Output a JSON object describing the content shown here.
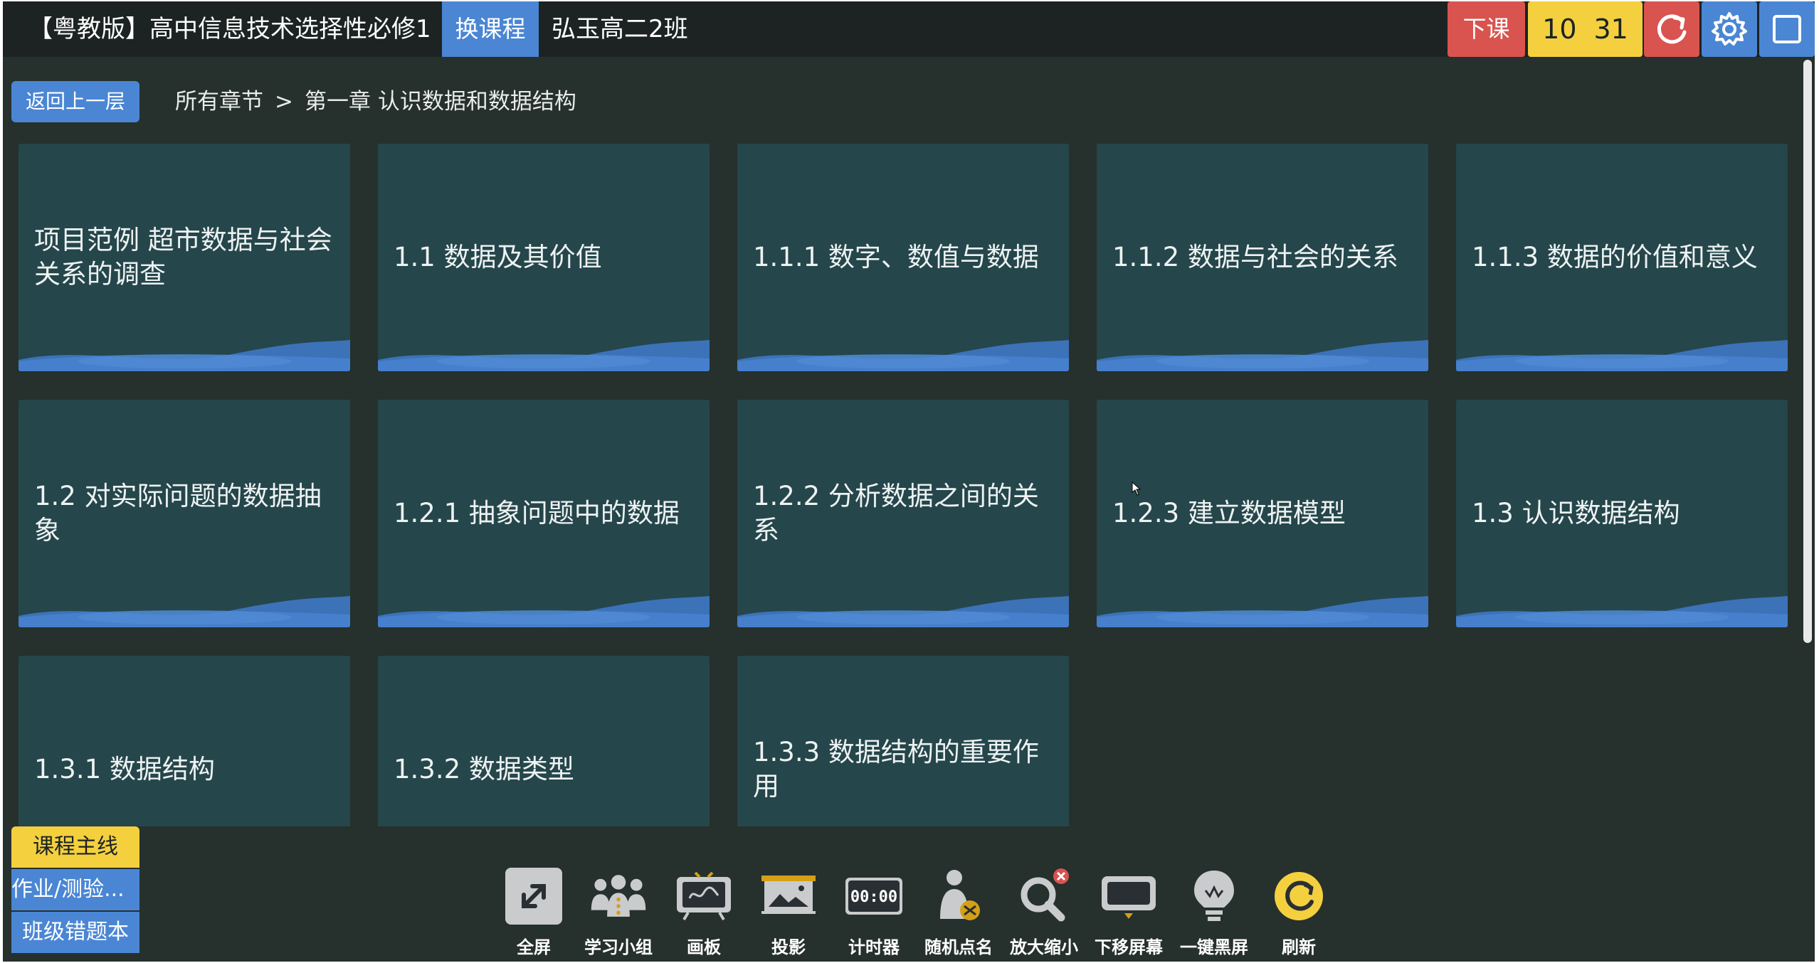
{
  "topbar": {
    "course_title": "【粤教版】高中信息技术选择性必修1",
    "switch_course": "换课程",
    "class_name": "弘玉高二2班",
    "end_class": "下课",
    "timer_min": "10",
    "timer_sec": "31",
    "icons": [
      "refresh-icon",
      "gear-icon",
      "window-icon"
    ]
  },
  "nav": {
    "back": "返回上一层",
    "crumb_root": "所有章节",
    "crumb_sep": ">",
    "crumb_current": "第一章 认识数据和数据结构"
  },
  "cards": [
    "项目范例 超市数据与社会关系的调查",
    "1.1 数据及其价值",
    "1.1.1 数字、数值与数据",
    "1.1.2 数据与社会的关系",
    "1.1.3 数据的价值和意义",
    "1.2 对实际问题的数据抽象",
    "1.2.1 抽象问题中的数据",
    "1.2.2 分析数据之间的关系",
    "1.2.3 建立数据模型",
    "1.3 认识数据结构",
    "1.3.1 数据结构",
    "1.3.2 数据类型",
    "1.3.3 数据结构的重要作用"
  ],
  "side": {
    "main_line": "课程主线",
    "homework": "作业/测验...",
    "wrong_book": "班级错题本"
  },
  "toolbar": [
    {
      "label": "全屏",
      "icon": "fullscreen-icon"
    },
    {
      "label": "学习小组",
      "icon": "group-icon"
    },
    {
      "label": "画板",
      "icon": "drawing-board-icon"
    },
    {
      "label": "投影",
      "icon": "projector-icon"
    },
    {
      "label": "计时器",
      "icon": "timer-icon",
      "display": "00:00"
    },
    {
      "label": "随机点名",
      "icon": "random-pick-icon"
    },
    {
      "label": "放大缩小",
      "icon": "magnifier-icon"
    },
    {
      "label": "下移屏幕",
      "icon": "screen-down-icon"
    },
    {
      "label": "一键黑屏",
      "icon": "lightbulb-icon"
    },
    {
      "label": "刷新",
      "icon": "refresh-icon"
    }
  ],
  "colors": {
    "background": "#26302d",
    "topbar": "#1c2322",
    "card": "#25464b",
    "blue": "#4a86d4",
    "red": "#d9534f",
    "yellow": "#f4d03f"
  }
}
